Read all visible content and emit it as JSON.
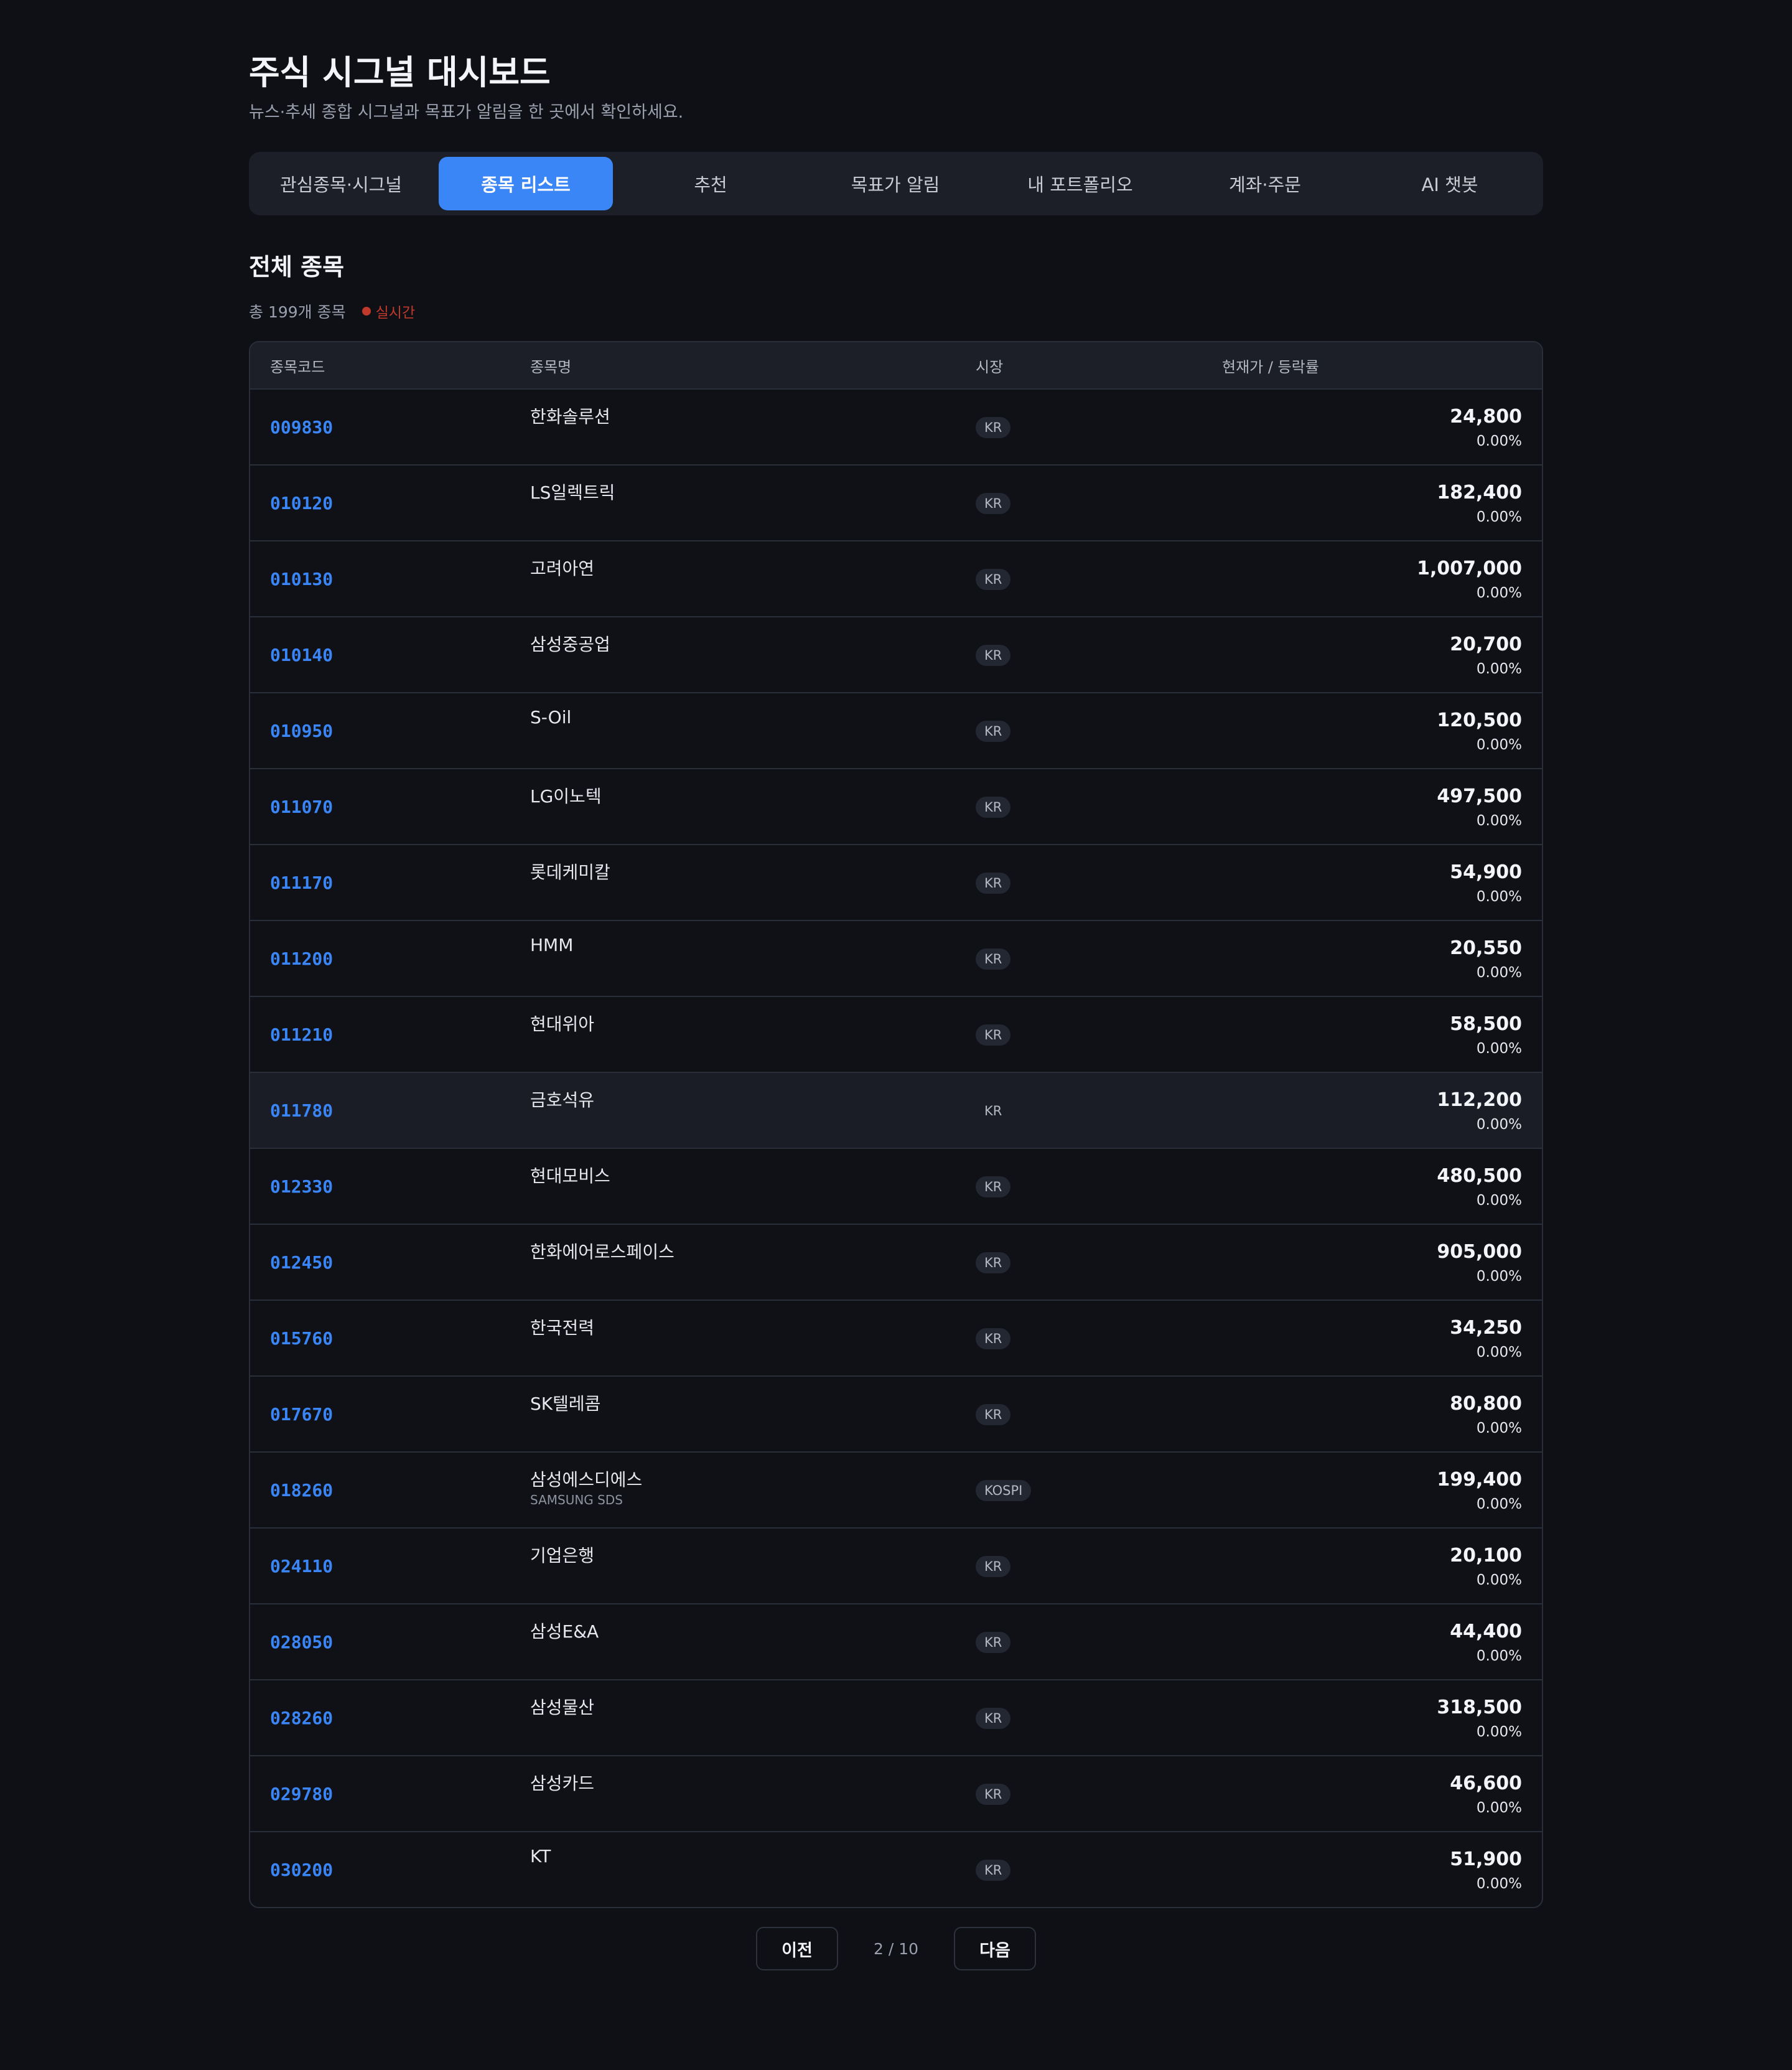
{
  "header": {
    "title": "주식 시그널 대시보드",
    "subtitle": "뉴스·추세 종합 시그널과 목표가 알림을 한 곳에서 확인하세요."
  },
  "tabs": [
    {
      "label": "관심종목·시그널",
      "active": false
    },
    {
      "label": "종목 리스트",
      "active": true
    },
    {
      "label": "추천",
      "active": false
    },
    {
      "label": "목표가 알림",
      "active": false
    },
    {
      "label": "내 포트폴리오",
      "active": false
    },
    {
      "label": "계좌·주문",
      "active": false
    },
    {
      "label": "AI 챗봇",
      "active": false
    }
  ],
  "section": {
    "title": "전체 종목",
    "count_text": "총 199개 종목",
    "live_label": "실시간"
  },
  "table": {
    "headers": {
      "code": "종목코드",
      "name": "종목명",
      "market": "시장",
      "price": "현재가 / 등락률"
    },
    "rows": [
      {
        "code": "009830",
        "name": "한화솔루션",
        "sub": "",
        "market": "KR",
        "price": "24,800",
        "change": "0.00%"
      },
      {
        "code": "010120",
        "name": "LS일렉트릭",
        "sub": "",
        "market": "KR",
        "price": "182,400",
        "change": "0.00%"
      },
      {
        "code": "010130",
        "name": "고려아연",
        "sub": "",
        "market": "KR",
        "price": "1,007,000",
        "change": "0.00%"
      },
      {
        "code": "010140",
        "name": "삼성중공업",
        "sub": "",
        "market": "KR",
        "price": "20,700",
        "change": "0.00%"
      },
      {
        "code": "010950",
        "name": "S-Oil",
        "sub": "",
        "market": "KR",
        "price": "120,500",
        "change": "0.00%"
      },
      {
        "code": "011070",
        "name": "LG이노텍",
        "sub": "",
        "market": "KR",
        "price": "497,500",
        "change": "0.00%"
      },
      {
        "code": "011170",
        "name": "롯데케미칼",
        "sub": "",
        "market": "KR",
        "price": "54,900",
        "change": "0.00%"
      },
      {
        "code": "011200",
        "name": "HMM",
        "sub": "",
        "market": "KR",
        "price": "20,550",
        "change": "0.00%"
      },
      {
        "code": "011210",
        "name": "현대위아",
        "sub": "",
        "market": "KR",
        "price": "58,500",
        "change": "0.00%"
      },
      {
        "code": "011780",
        "name": "금호석유",
        "sub": "",
        "market": "KR",
        "price": "112,200",
        "change": "0.00%"
      },
      {
        "code": "012330",
        "name": "현대모비스",
        "sub": "",
        "market": "KR",
        "price": "480,500",
        "change": "0.00%"
      },
      {
        "code": "012450",
        "name": "한화에어로스페이스",
        "sub": "",
        "market": "KR",
        "price": "905,000",
        "change": "0.00%"
      },
      {
        "code": "015760",
        "name": "한국전력",
        "sub": "",
        "market": "KR",
        "price": "34,250",
        "change": "0.00%"
      },
      {
        "code": "017670",
        "name": "SK텔레콤",
        "sub": "",
        "market": "KR",
        "price": "80,800",
        "change": "0.00%"
      },
      {
        "code": "018260",
        "name": "삼성에스디에스",
        "sub": "SAMSUNG SDS",
        "market": "KOSPI",
        "price": "199,400",
        "change": "0.00%"
      },
      {
        "code": "024110",
        "name": "기업은행",
        "sub": "",
        "market": "KR",
        "price": "20,100",
        "change": "0.00%"
      },
      {
        "code": "028050",
        "name": "삼성E&A",
        "sub": "",
        "market": "KR",
        "price": "44,400",
        "change": "0.00%"
      },
      {
        "code": "028260",
        "name": "삼성물산",
        "sub": "",
        "market": "KR",
        "price": "318,500",
        "change": "0.00%"
      },
      {
        "code": "029780",
        "name": "삼성카드",
        "sub": "",
        "market": "KR",
        "price": "46,600",
        "change": "0.00%"
      },
      {
        "code": "030200",
        "name": "KT",
        "sub": "",
        "market": "KR",
        "price": "51,900",
        "change": "0.00%"
      }
    ],
    "hover_row_index": 9
  },
  "pagination": {
    "prev_label": "이전",
    "page_info": "2 / 10",
    "next_label": "다음"
  },
  "colors": {
    "accent": "#3b86f6",
    "live": "#c0392b",
    "background": "#0e1016"
  }
}
